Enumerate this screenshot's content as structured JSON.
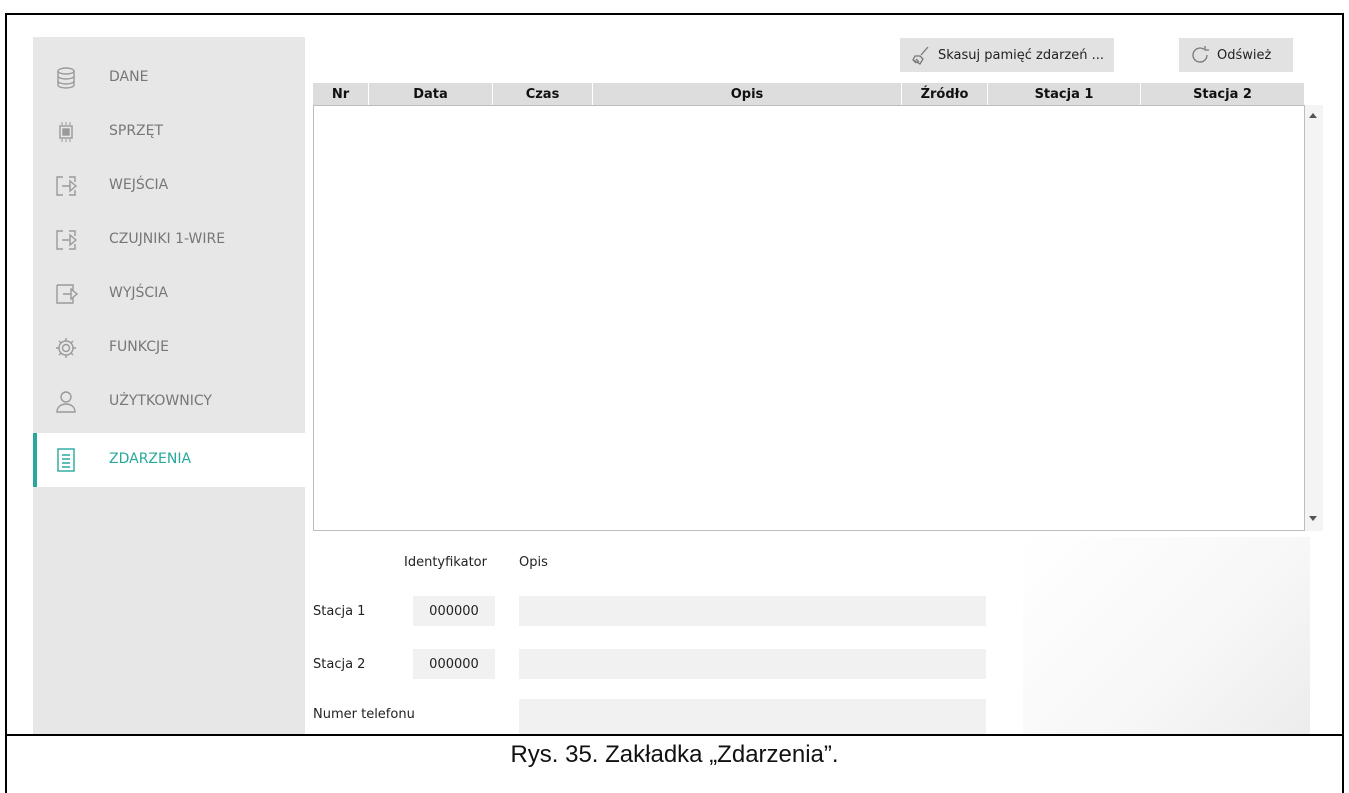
{
  "sidebar": {
    "items": [
      {
        "label": "DANE",
        "icon": "database-icon"
      },
      {
        "label": "SPRZĘT",
        "icon": "chip-icon"
      },
      {
        "label": "WEJŚCIA",
        "icon": "input-icon"
      },
      {
        "label": "CZUJNIKI 1-WIRE",
        "icon": "sensor-icon"
      },
      {
        "label": "WYJŚCIA",
        "icon": "output-icon"
      },
      {
        "label": "FUNKCJE",
        "icon": "gear-icon"
      },
      {
        "label": "UŻYTKOWNICY",
        "icon": "user-icon"
      },
      {
        "label": "ZDARZENIA",
        "icon": "document-icon"
      }
    ],
    "active_index": 7,
    "accent_color": "#26a89c"
  },
  "toolbar": {
    "clear_label": "Skasuj pamięć zdarzeń ...",
    "refresh_label": "Odśwież"
  },
  "table": {
    "columns": [
      "Nr",
      "Data",
      "Czas",
      "Opis",
      "Źródło",
      "Stacja 1",
      "Stacja 2"
    ],
    "rows": []
  },
  "details": {
    "identifier_header": "Identyfikator",
    "description_header": "Opis",
    "station1_label": "Stacja 1",
    "station1_id": "000000",
    "station1_desc": "",
    "station2_label": "Stacja 2",
    "station2_id": "000000",
    "station2_desc": "",
    "phone_label": "Numer telefonu",
    "phone_value": ""
  },
  "caption": "Rys. 35. Zakładka „Zdarzenia”."
}
